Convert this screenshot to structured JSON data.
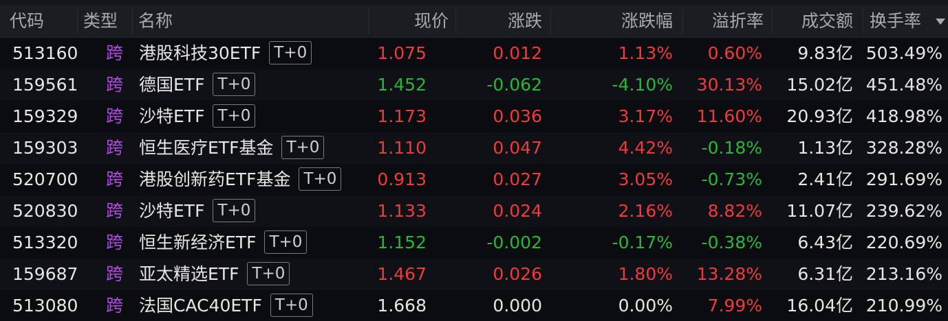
{
  "header": {
    "code": "代码",
    "type": "类型",
    "name": "名称",
    "price": "现价",
    "change": "涨跌",
    "change_pct": "涨跌幅",
    "premium": "溢折率",
    "turnover_amount": "成交额",
    "turnover_rate": "换手率",
    "sort_icon": "sort-desc-icon"
  },
  "colors": {
    "up": "#ee3b3b",
    "down": "#2bb63a",
    "flat": "#e6e6e6",
    "type": "#b04ce0"
  },
  "rows": [
    {
      "code": "513160",
      "type": "跨",
      "name": "港股科技30ETF",
      "badge": "T+0",
      "price": "1.075",
      "change": "0.012",
      "change_pct": "1.13%",
      "premium": "0.60%",
      "amount": "9.83亿",
      "rate": "503.49%",
      "price_dir": "up",
      "chg_dir": "up",
      "prem_dir": "up"
    },
    {
      "code": "159561",
      "type": "跨",
      "name": "德国ETF",
      "badge": "T+0",
      "price": "1.452",
      "change": "-0.062",
      "change_pct": "-4.10%",
      "premium": "30.13%",
      "amount": "15.02亿",
      "rate": "451.48%",
      "price_dir": "down",
      "chg_dir": "down",
      "prem_dir": "up"
    },
    {
      "code": "159329",
      "type": "跨",
      "name": "沙特ETF",
      "badge": "T+0",
      "price": "1.173",
      "change": "0.036",
      "change_pct": "3.17%",
      "premium": "11.60%",
      "amount": "20.93亿",
      "rate": "418.98%",
      "price_dir": "up",
      "chg_dir": "up",
      "prem_dir": "up"
    },
    {
      "code": "159303",
      "type": "跨",
      "name": "恒生医疗ETF基金",
      "badge": "T+0",
      "price": "1.110",
      "change": "0.047",
      "change_pct": "4.42%",
      "premium": "-0.18%",
      "amount": "1.13亿",
      "rate": "328.28%",
      "price_dir": "up",
      "chg_dir": "up",
      "prem_dir": "down"
    },
    {
      "code": "520700",
      "type": "跨",
      "name": "港股创新药ETF基金",
      "badge": "T+0",
      "price": "0.913",
      "change": "0.027",
      "change_pct": "3.05%",
      "premium": "-0.73%",
      "amount": "2.41亿",
      "rate": "291.69%",
      "price_dir": "up",
      "chg_dir": "up",
      "prem_dir": "down"
    },
    {
      "code": "520830",
      "type": "跨",
      "name": "沙特ETF",
      "badge": "T+0",
      "price": "1.133",
      "change": "0.024",
      "change_pct": "2.16%",
      "premium": "8.82%",
      "amount": "11.07亿",
      "rate": "239.62%",
      "price_dir": "up",
      "chg_dir": "up",
      "prem_dir": "up"
    },
    {
      "code": "513320",
      "type": "跨",
      "name": "恒生新经济ETF",
      "badge": "T+0",
      "price": "1.152",
      "change": "-0.002",
      "change_pct": "-0.17%",
      "premium": "-0.38%",
      "amount": "6.43亿",
      "rate": "220.69%",
      "price_dir": "down",
      "chg_dir": "down",
      "prem_dir": "down"
    },
    {
      "code": "159687",
      "type": "跨",
      "name": "亚太精选ETF",
      "badge": "T+0",
      "price": "1.467",
      "change": "0.026",
      "change_pct": "1.80%",
      "premium": "13.28%",
      "amount": "6.31亿",
      "rate": "213.16%",
      "price_dir": "up",
      "chg_dir": "up",
      "prem_dir": "up"
    },
    {
      "code": "513080",
      "type": "跨",
      "name": "法国CAC40ETF",
      "badge": "T+0",
      "price": "1.668",
      "change": "0.000",
      "change_pct": "0.00%",
      "premium": "7.99%",
      "amount": "16.04亿",
      "rate": "210.99%",
      "price_dir": "flat",
      "chg_dir": "flat",
      "prem_dir": "up"
    }
  ]
}
